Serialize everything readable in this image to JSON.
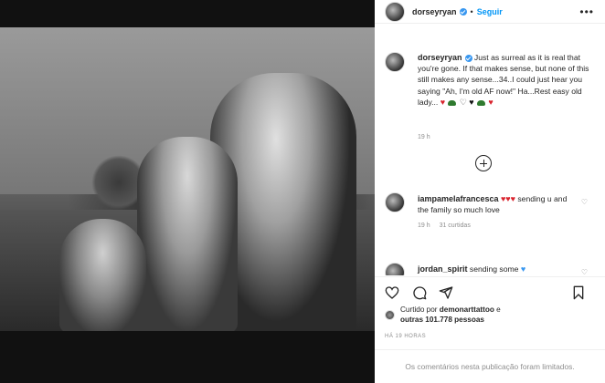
{
  "post": {
    "username": "dorseyryan",
    "follow_label": "Seguir",
    "dot": "•",
    "more_label": "•••",
    "caption_text": "Just as surreal as it is real that you're gone. If that makes sense, but none of this still makes any sense...34..I could just hear you saying \"Ah, I'm old AF now!\" Ha...Rest easy old lady...",
    "caption_time": "19 h"
  },
  "comments": [
    {
      "username": "iampamelafrancesca",
      "text": "sending u and the family so much love",
      "time": "19 h",
      "likes": "31 curtidas"
    },
    {
      "username": "jordan_spirit",
      "text": "sending some"
    }
  ],
  "liked_by": {
    "prefix": "Curtido por",
    "user": "demonarttattoo",
    "connector": "e",
    "others": "outras 101.778 pessoas"
  },
  "ago": "HÁ 19 HORAS",
  "footer_note": "Os comentários nesta publicação foram limitados.",
  "colors": {
    "link_blue": "#0095f6",
    "verified_blue": "#3897f0",
    "heart_red": "#d9232d",
    "muted": "#8e8e8e"
  }
}
